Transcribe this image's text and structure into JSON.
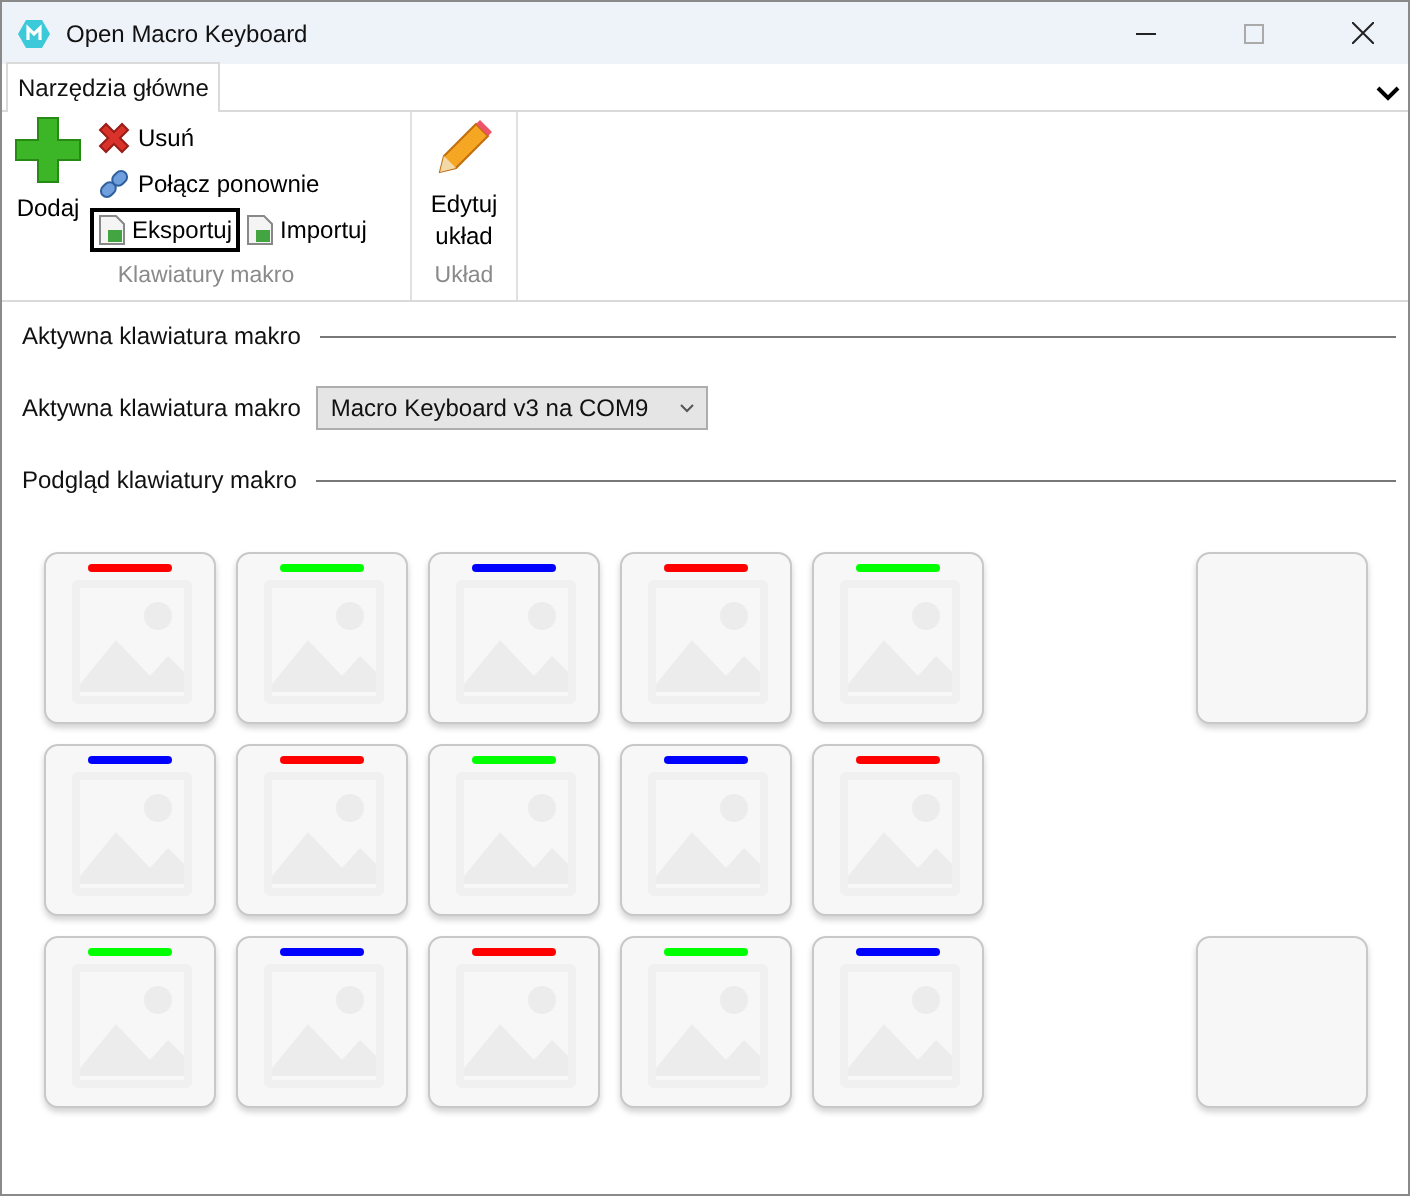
{
  "window": {
    "title": "Open Macro Keyboard"
  },
  "ribbon": {
    "tabs": [
      {
        "label": "Narzędzia główne",
        "selected": true
      }
    ],
    "groups": [
      {
        "label": "Klawiatury makro",
        "large": [
          {
            "label": "Dodaj",
            "kind": "plus"
          }
        ],
        "small": [
          {
            "label": "Usuń",
            "kind": "x",
            "focused": false
          },
          {
            "label": "Połącz ponownie",
            "kind": "link",
            "focused": false
          },
          {
            "label": "Eksportuj",
            "kind": "export",
            "focused": true
          },
          {
            "label": "Importuj",
            "kind": "import",
            "focused": false
          }
        ]
      },
      {
        "label": "Układ",
        "large": [
          {
            "label": "Edytuj układ",
            "kind": "pencil"
          }
        ]
      }
    ]
  },
  "active_section": {
    "heading": "Aktywna klawiatura makro",
    "field_label": "Aktywna klawiatura makro",
    "dropdown_value": "Macro Keyboard v3 na COM9"
  },
  "preview_section": {
    "heading": "Podgląd klawiatury makro",
    "rows": [
      [
        {
          "kind": "macro",
          "color": "#ff0000"
        },
        {
          "kind": "macro",
          "color": "#00ff00"
        },
        {
          "kind": "macro",
          "color": "#0000ff"
        },
        {
          "kind": "macro",
          "color": "#ff0000"
        },
        {
          "kind": "macro",
          "color": "#00ff00"
        },
        {
          "kind": "empty"
        },
        {
          "kind": "plain"
        }
      ],
      [
        {
          "kind": "macro",
          "color": "#0000ff"
        },
        {
          "kind": "macro",
          "color": "#ff0000"
        },
        {
          "kind": "macro",
          "color": "#00ff00"
        },
        {
          "kind": "macro",
          "color": "#0000ff"
        },
        {
          "kind": "macro",
          "color": "#ff0000"
        },
        {
          "kind": "empty"
        },
        {
          "kind": "empty"
        }
      ],
      [
        {
          "kind": "macro",
          "color": "#00ff00"
        },
        {
          "kind": "macro",
          "color": "#0000ff"
        },
        {
          "kind": "macro",
          "color": "#ff0000"
        },
        {
          "kind": "macro",
          "color": "#00ff00"
        },
        {
          "kind": "macro",
          "color": "#0000ff"
        },
        {
          "kind": "empty"
        },
        {
          "kind": "plain"
        }
      ]
    ]
  }
}
